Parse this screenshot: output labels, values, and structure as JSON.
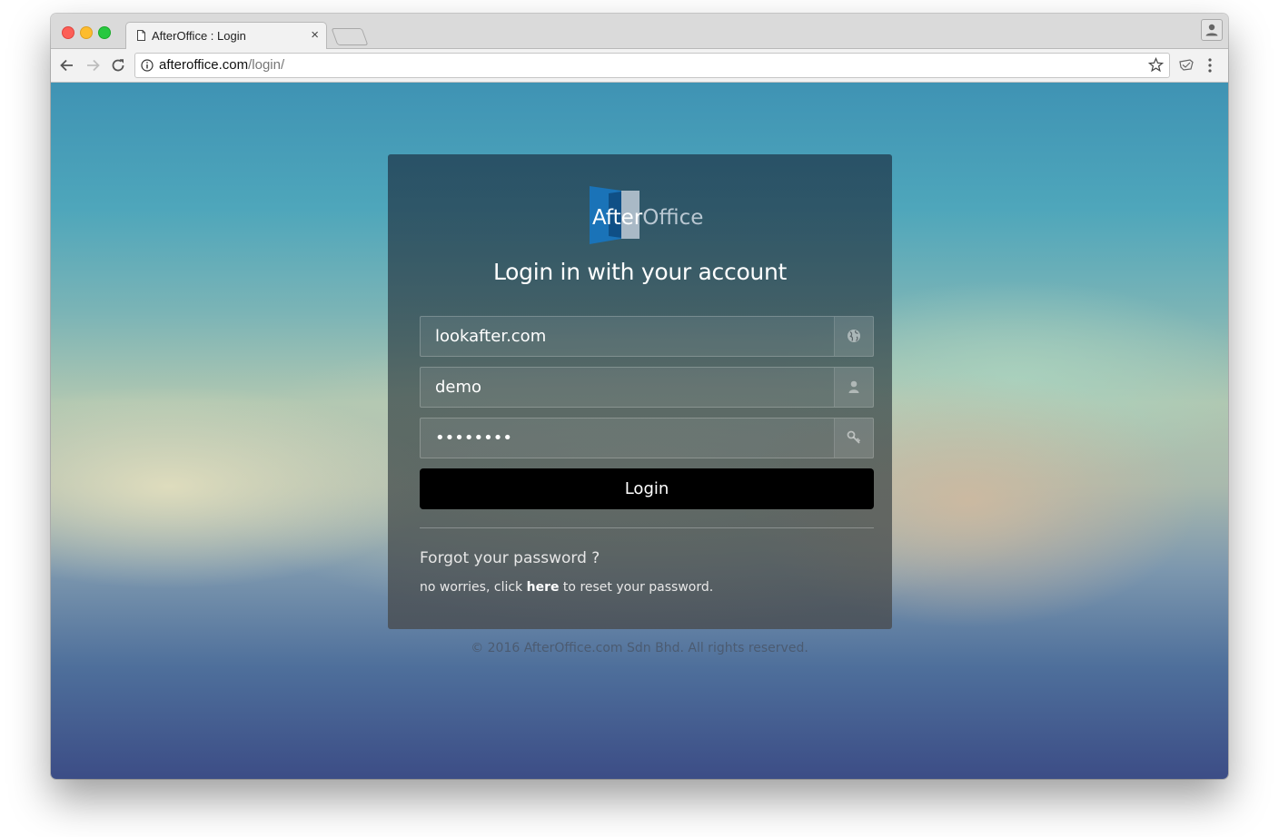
{
  "browser": {
    "tab_title": "AfterOffice : Login",
    "tab_close": "×",
    "url_host": "afteroffice.com",
    "url_path": "/login/"
  },
  "login": {
    "logo_after": "After",
    "logo_office": "Office",
    "title": "Login in with your account",
    "domain_value": "lookafter.com",
    "username_value": "demo",
    "password_value": "secret12",
    "login_button": "Login",
    "forgot_title": "Forgot your password ?",
    "forgot_prefix": "no worries, click ",
    "forgot_link": "here",
    "forgot_suffix": " to reset your password."
  },
  "footer": {
    "copyright": "© 2016 AfterOffice.com Sdn Bhd. All rights reserved."
  },
  "colors": {
    "logo_blue": "#1a73b8",
    "button_bg": "#000000",
    "close_red": "#fc5f57",
    "minimize_yellow": "#fdbc2e",
    "zoom_green": "#28c840"
  },
  "icons": {
    "domain_field": "globe-icon",
    "username_field": "user-icon",
    "password_field": "key-icon"
  }
}
